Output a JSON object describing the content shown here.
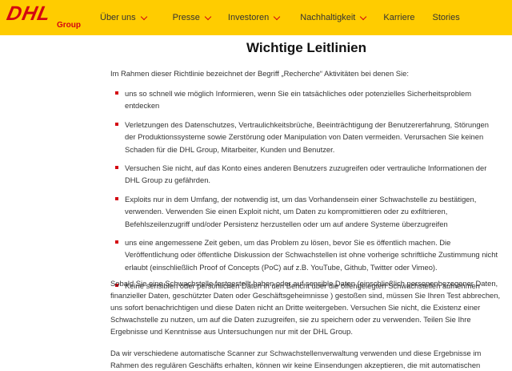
{
  "brand": {
    "name": "DHL",
    "sub": "Group",
    "colors": {
      "yellow": "#ffcc00",
      "red": "#d40511"
    }
  },
  "nav": {
    "items": [
      {
        "label": "Über uns",
        "has_dropdown": true
      },
      {
        "label": "Presse",
        "has_dropdown": true
      },
      {
        "label": "Investoren",
        "has_dropdown": true
      },
      {
        "label": "Nachhaltigkeit",
        "has_dropdown": true
      },
      {
        "label": "Karriere",
        "has_dropdown": false
      },
      {
        "label": "Stories",
        "has_dropdown": false
      }
    ]
  },
  "page": {
    "title": "Wichtige Leitlinien",
    "intro": "Im Rahmen dieser Richtlinie bezeichnet der Begriff „Recherche“ Aktivitäten bei denen Sie:",
    "bullets": [
      "uns so schnell wie möglich Informieren, wenn Sie ein tatsächliches oder potenzielles Sicherheitsproblem entdecken",
      "Verletzungen des Datenschutzes, Vertraulichkeitsbrüche, Beeinträchtigung der Benutzererfahrung, Störungen der Produktionssysteme sowie Zerstörung oder Manipulation von Daten vermeiden. Verursachen Sie keinen Schaden für die DHL Group, Mitarbeiter, Kunden und Benutzer.",
      "Versuchen Sie nicht, auf das Konto eines anderen Benutzers zuzugreifen oder vertrauliche Informationen der DHL Group zu gefährden.",
      "Exploits nur in dem Umfang, der notwendig ist, um das Vorhandensein einer Schwachstelle zu bestätigen, verwenden. Verwenden Sie einen Exploit nicht, um Daten zu kompromittieren oder zu exfiltrieren, Befehlszeilenzugriff und/oder Persistenz herzustellen oder  um auf andere Systeme überzugreifen",
      "uns eine angemessene Zeit geben, um das Problem zu lösen, bevor Sie es öffentlich machen. Die Veröffentlichung oder öffentliche Diskussion der Schwachstellen ist ohne vorherige schriftliche Zustimmung nicht erlaubt (einschließlich Proof of Concepts (PoC) auf z.B. YouTube, Github, Twitter oder Vimeo).",
      "Keine sensiblen oder persönlichen Daten in den Bericht über die offengelegten Schwachstellen aufnehmen"
    ],
    "para2": "Sobald Sie eine Schwachstelle festgestellt haben oder auf sensible Daten (einschließlich personenbezogener Daten, finanzieller Daten,  geschützter Daten oder Geschäftsgeheimnisse ) gestoßen sind, müssen Sie Ihren Test abbrechen, uns sofort benachrichtigen und diese Daten nicht an Dritte weitergeben. Versuchen Sie nicht, die Existenz einer Schwachstelle zu nutzen, um auf die Daten zuzugreifen, sie zu speichern oder zu verwenden. Teilen Sie Ihre Ergebnisse und Kenntnisse aus Untersuchungen nur mit der DHL Group.",
    "para3": "Da wir verschiedene automatische Scanner zur Schwachstellenverwaltung verwenden und diese Ergebnisse im Rahmen des regulären Geschäfts erhalten, können wir keine Einsendungen akzeptieren, die mit automatischen"
  }
}
